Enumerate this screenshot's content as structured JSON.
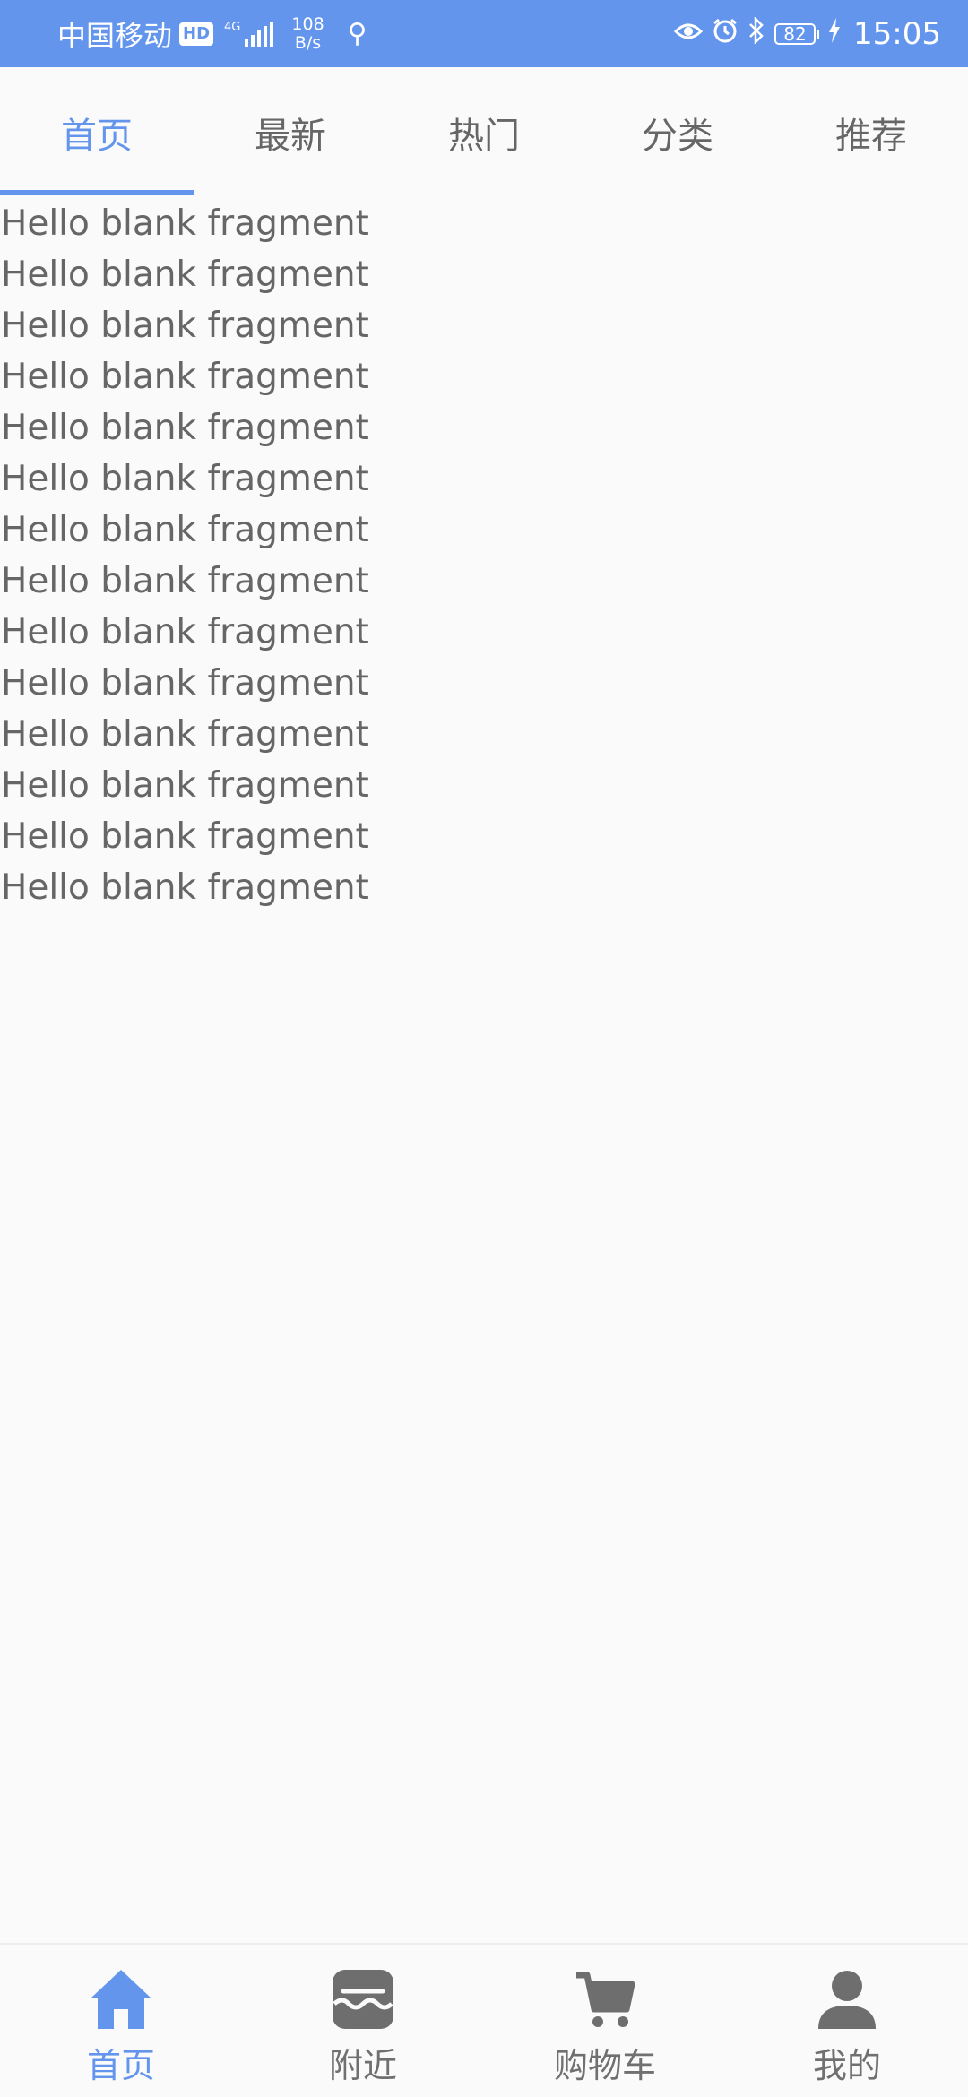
{
  "status_bar": {
    "carrier": "中国移动",
    "hd_badge": "HD",
    "network": "4G",
    "speed_value": "108",
    "speed_unit": "B/s",
    "battery": "82",
    "time": "15:05",
    "icons": [
      "eye-icon",
      "alarm-icon",
      "bluetooth-icon",
      "usb-icon",
      "charging-icon"
    ]
  },
  "top_tabs": [
    {
      "label": "首页",
      "active": true
    },
    {
      "label": "最新",
      "active": false
    },
    {
      "label": "热门",
      "active": false
    },
    {
      "label": "分类",
      "active": false
    },
    {
      "label": "推荐",
      "active": false
    }
  ],
  "content_lines": [
    "Hello blank fragment",
    "Hello blank fragment",
    "Hello blank fragment",
    "Hello blank fragment",
    "Hello blank fragment",
    "Hello blank fragment",
    "Hello blank fragment",
    "Hello blank fragment",
    "Hello blank fragment",
    "Hello blank fragment",
    "Hello blank fragment",
    "Hello blank fragment",
    "Hello blank fragment",
    "Hello blank fragment"
  ],
  "bottom_nav": [
    {
      "label": "首页",
      "icon": "home-icon",
      "active": true
    },
    {
      "label": "附近",
      "icon": "store-icon",
      "active": false
    },
    {
      "label": "购物车",
      "icon": "cart-icon",
      "active": false
    },
    {
      "label": "我的",
      "icon": "person-icon",
      "active": false
    }
  ],
  "colors": {
    "accent": "#6495ed",
    "text": "#666666",
    "background": "#fafafa"
  }
}
